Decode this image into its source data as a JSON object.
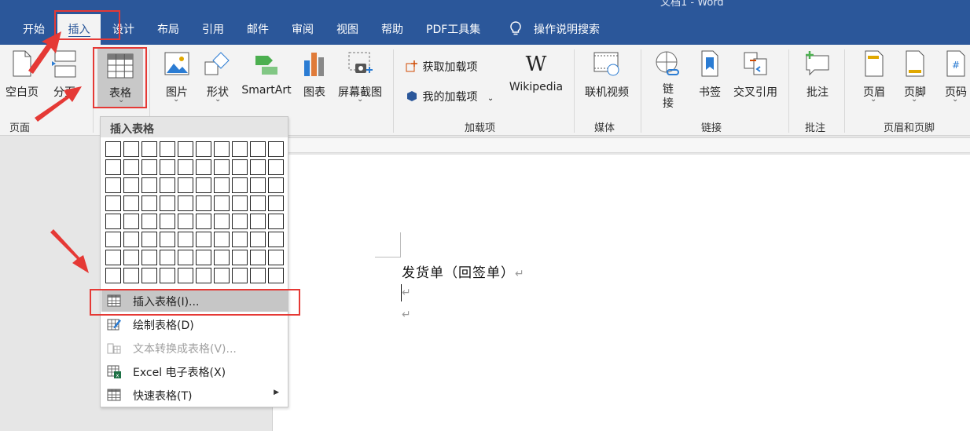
{
  "window": {
    "title": "文档1 - Word"
  },
  "tabs": [
    "开始",
    "插入",
    "设计",
    "布局",
    "引用",
    "邮件",
    "审阅",
    "视图",
    "帮助",
    "PDF工具集"
  ],
  "active_tab": "插入",
  "tell_me": "操作说明搜索",
  "ribbon": {
    "pages": {
      "blank_page": "空白页",
      "page_break": "分页",
      "group": "页面"
    },
    "tables": {
      "table": "表格"
    },
    "illustrations": {
      "pictures": "图片",
      "shapes": "形状",
      "smartart": "SmartArt",
      "chart": "图表",
      "screenshot": "屏幕截图"
    },
    "addins": {
      "get_addins": "获取加载项",
      "my_addins": "我的加载项",
      "wikipedia": "Wikipedia",
      "group": "加载项"
    },
    "media": {
      "online_video": "联机视频",
      "group": "媒体"
    },
    "links": {
      "link_top": "链",
      "link_bottom": "接",
      "bookmark": "书签",
      "cross_ref": "交叉引用",
      "group": "链接"
    },
    "comments": {
      "comment": "批注",
      "group": "批注"
    },
    "header_footer": {
      "header": "页眉",
      "footer": "页脚",
      "page_number": "页码",
      "group": "页眉和页脚"
    }
  },
  "dropdown": {
    "header": "插入表格",
    "grid": {
      "columns": 10,
      "rows": 8
    },
    "items": [
      {
        "label": "插入表格(I)...",
        "icon": "table-icon",
        "state": "highlighted"
      },
      {
        "label": "绘制表格(D)",
        "icon": "pencil-table-icon",
        "state": "normal"
      },
      {
        "label": "文本转换成表格(V)...",
        "icon": "text-to-table-icon",
        "state": "disabled"
      },
      {
        "label": "Excel 电子表格(X)",
        "icon": "excel-icon",
        "state": "normal"
      },
      {
        "label": "快速表格(T)",
        "icon": "quick-table-icon",
        "state": "normal",
        "submenu": true
      }
    ]
  },
  "document": {
    "line1": "发货单（回签单）",
    "para_mark": "↵"
  },
  "colors": {
    "title_bar": "#2b579a",
    "annotation": "#e53935",
    "ribbon_bg": "#f3f3f3"
  }
}
